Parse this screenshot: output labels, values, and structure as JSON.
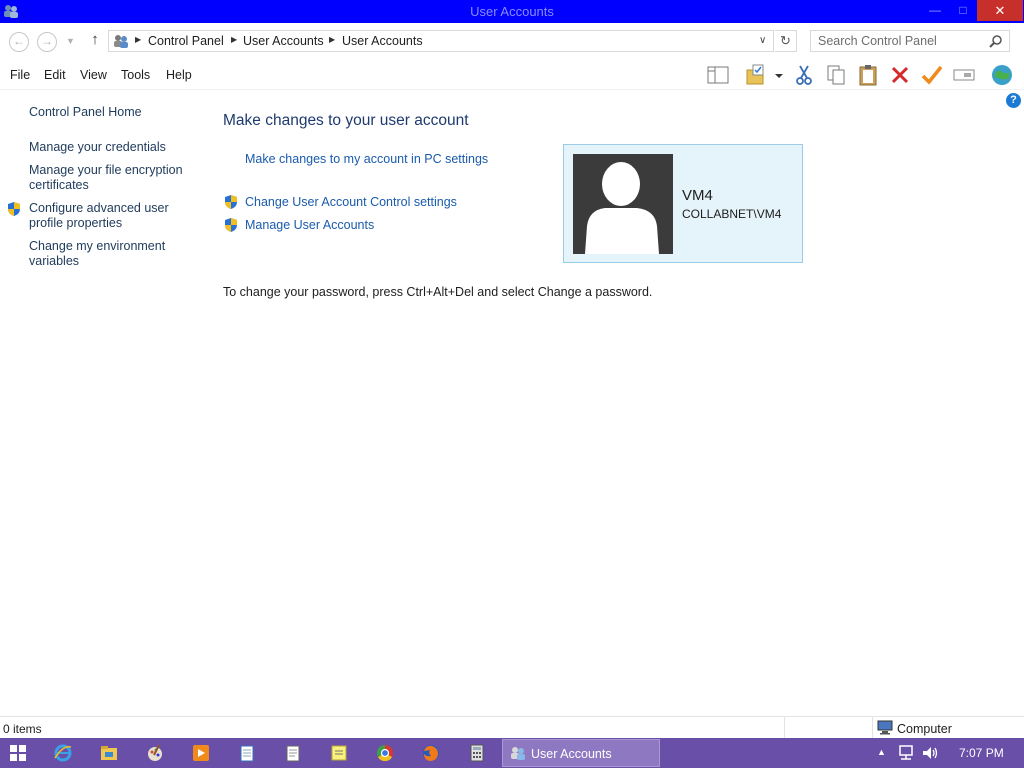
{
  "window": {
    "title": "User Accounts",
    "minimize_glyph": "—",
    "maximize_glyph": "□",
    "close_glyph": "✕"
  },
  "address": {
    "back_glyph": "←",
    "forward_glyph": "→",
    "recent_glyph": "▼",
    "up_glyph": "↑",
    "breadcrumbs": [
      "Control Panel",
      "User Accounts",
      "User Accounts"
    ],
    "breadcrumb_sep": "▶",
    "dropdown_glyph": "∨",
    "refresh_glyph": "↻",
    "search_placeholder": "Search Control Panel"
  },
  "menu": {
    "items": [
      "File",
      "Edit",
      "View",
      "Tools",
      "Help"
    ]
  },
  "toolbar": {
    "icons": [
      "layout-icon",
      "folder-options-icon",
      "cut-icon",
      "copy-icon",
      "paste-icon",
      "delete-icon",
      "properties-check-icon",
      "rename-icon",
      "globe-icon"
    ],
    "help_glyph": "?"
  },
  "sidebar": {
    "home": "Control Panel Home",
    "links": [
      "Manage your credentials",
      "Manage your file encryption certificates",
      "Configure advanced user profile properties",
      "Change my environment variables"
    ]
  },
  "main": {
    "heading": "Make changes to your user account",
    "pc_settings_link": "Make changes to my account in PC settings",
    "uac_link": "Change User Account Control settings",
    "manage_link": "Manage User Accounts",
    "password_info": "To change your password, press Ctrl+Alt+Del and select Change a password."
  },
  "account": {
    "name": "VM4",
    "domain": "COLLABNET\\VM4"
  },
  "status": {
    "items": "0 items",
    "zone": "Computer"
  },
  "taskbar": {
    "pinned": [
      "internet-explorer-icon",
      "file-explorer-icon",
      "paint-icon",
      "media-player-icon",
      "notepad-icon",
      "sticky-notes-icon",
      "chrome-icon",
      "firefox-icon",
      "calculator-icon"
    ],
    "active_task": "User Accounts",
    "tray_arrow": "▲",
    "clock": "7:07 PM"
  },
  "colors": {
    "titlebar": "#0000ff",
    "link": "#1a5bab",
    "heading": "#1e3a6e",
    "card_bg": "#e5f3fb",
    "card_border": "#9ccbe5",
    "taskbar": "#6a4fa8",
    "close_button": "#c7302a"
  }
}
